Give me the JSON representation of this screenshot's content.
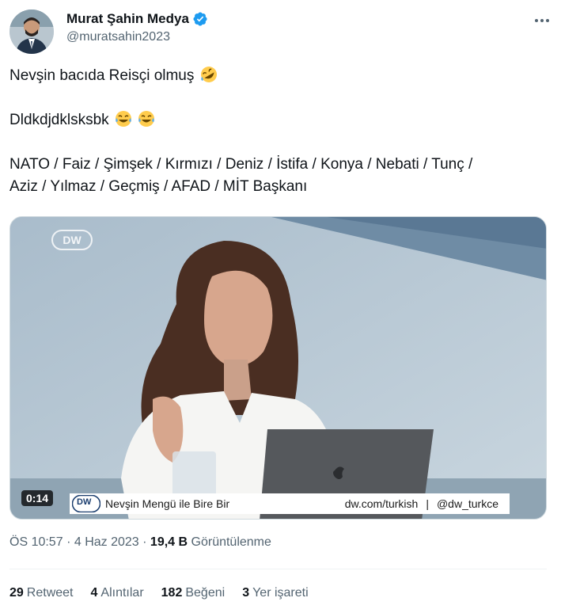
{
  "author": {
    "name": "Murat Şahin Medya",
    "handle": "@muratsahin2023"
  },
  "tweet": {
    "line1": "Nevşin bacıda Reisçi olmuş",
    "line1_emoji": "rolling-on-floor-laughing-emoji",
    "line2": "Dldkdjdklsksbk",
    "line2_emoji": "tears-of-joy-emoji",
    "line3": "NATO / Faiz / Şimşek / Kırmızı / Deniz / İstifa / Konya / Nebati / Tunç /",
    "line4": "Aziz / Yılmaz / Geçmiş / AFAD / MİT Başkanı"
  },
  "video": {
    "duration": "0:14",
    "watermark": "DW",
    "lower_third": {
      "logo": "DW",
      "show": "Nevşin Mengü ile Bire Bir",
      "site": "dw.com/turkish",
      "separator": "|",
      "handle": "@dw_turkce"
    }
  },
  "meta": {
    "time": "ÖS 10:57",
    "dot": "·",
    "date": "4 Haz 2023",
    "views_count": "19,4 B",
    "views_label": "Görüntülenme"
  },
  "stats": [
    {
      "count": "29",
      "label": "Retweet"
    },
    {
      "count": "4",
      "label": "Alıntılar"
    },
    {
      "count": "182",
      "label": "Beğeni"
    },
    {
      "count": "3",
      "label": "Yer işareti"
    }
  ],
  "colors": {
    "verified": "#1d9bf0",
    "secondary_text": "#536471",
    "primary_text": "#0f1419",
    "divider": "#eff3f4"
  }
}
